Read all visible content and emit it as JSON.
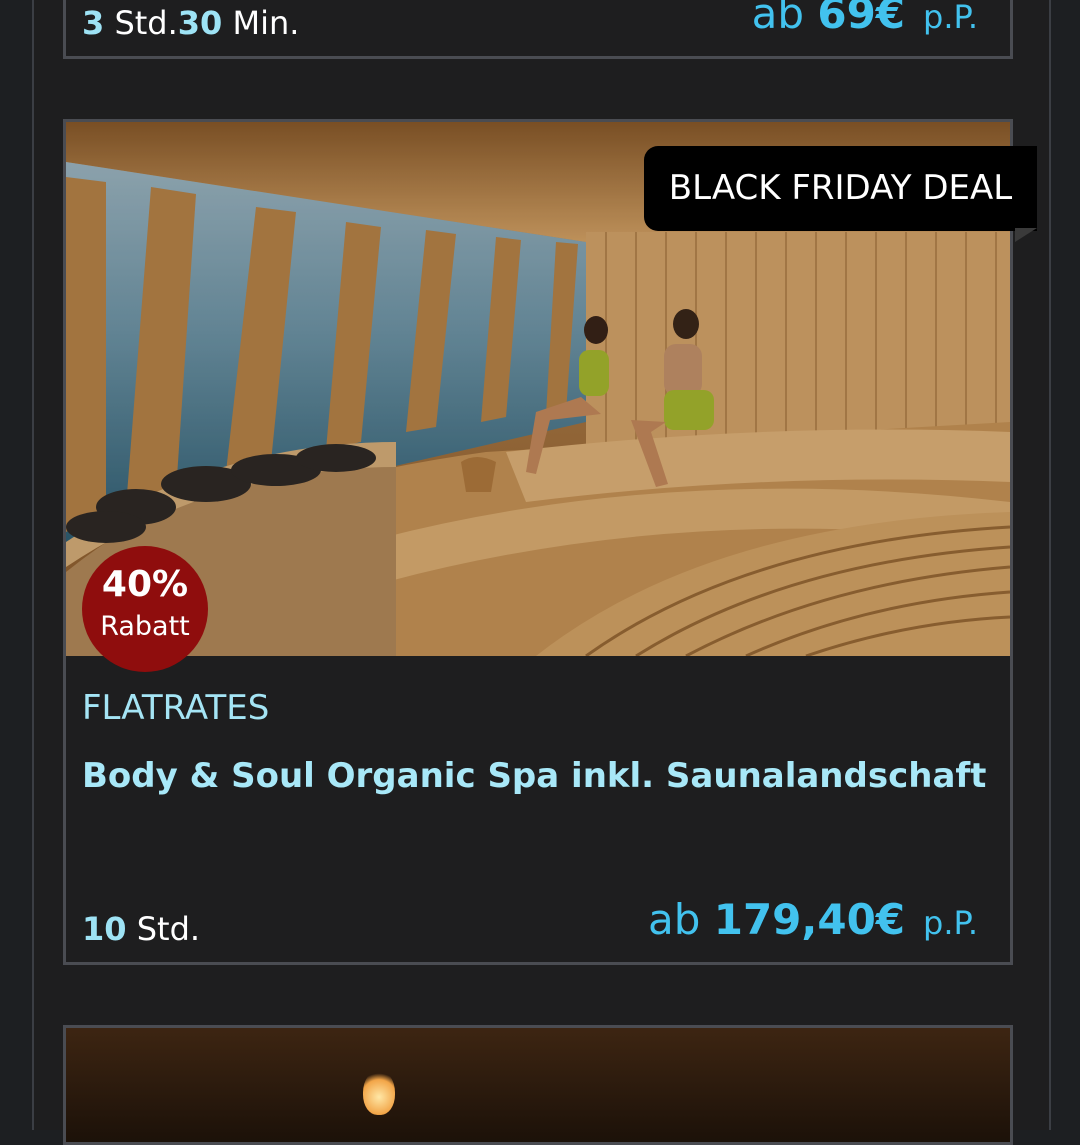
{
  "cards": [
    {
      "duration_hours": "3",
      "duration_hours_unit": "Std.",
      "duration_minutes": "30",
      "duration_minutes_unit": "Min.",
      "price_prefix": "ab",
      "price_amount": "69€",
      "price_suffix": "p.P."
    },
    {
      "ribbon": "BLACK FRIDAY DEAL",
      "discount_percent": "40%",
      "discount_label": "Rabatt",
      "category": "FLATRATES",
      "title": "Body & Soul Organic Spa inkl. Saunalandschaft",
      "duration_hours": "10",
      "duration_hours_unit": "Std.",
      "price_prefix": "ab",
      "price_amount": "179,40€",
      "price_suffix": "p.P."
    }
  ]
}
